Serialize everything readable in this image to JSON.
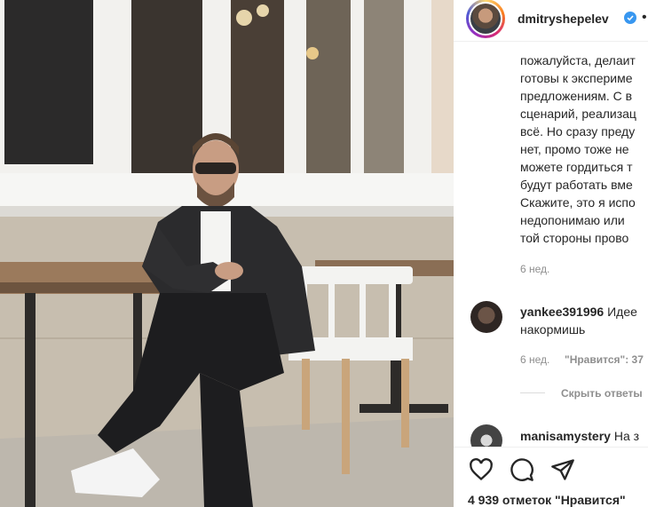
{
  "post": {
    "username": "dmitryshepelev",
    "more": "•"
  },
  "caption_lines": [
    "пожалуйста, делаит",
    "готовы к экспериме",
    "предложениям. С в",
    "сценарий, реализац",
    "всё. Но сразу преду",
    "нет, промо тоже не",
    "можете гордиться т",
    "будут работать вме",
    "Скажите, это я испо",
    "недопонимаю или",
    "той стороны прово"
  ],
  "caption_time": "6 нед.",
  "comments": [
    {
      "username": "yankee391996",
      "text_first": "Идее",
      "text_second": "накормишь",
      "time": "6 нед.",
      "likes": "\"Нравится\": 37",
      "hide_replies": "Скрыть ответы"
    },
    {
      "username": "manisamystery",
      "text_first": "На з"
    }
  ],
  "likes_text": "4 939 отметок \"Нравится\"",
  "icons": [
    "verified-badge-icon",
    "heart-icon",
    "comment-icon",
    "share-icon"
  ],
  "colors": {
    "verified": "#3897f0",
    "text": "#262626",
    "muted": "#8e8e8e"
  }
}
